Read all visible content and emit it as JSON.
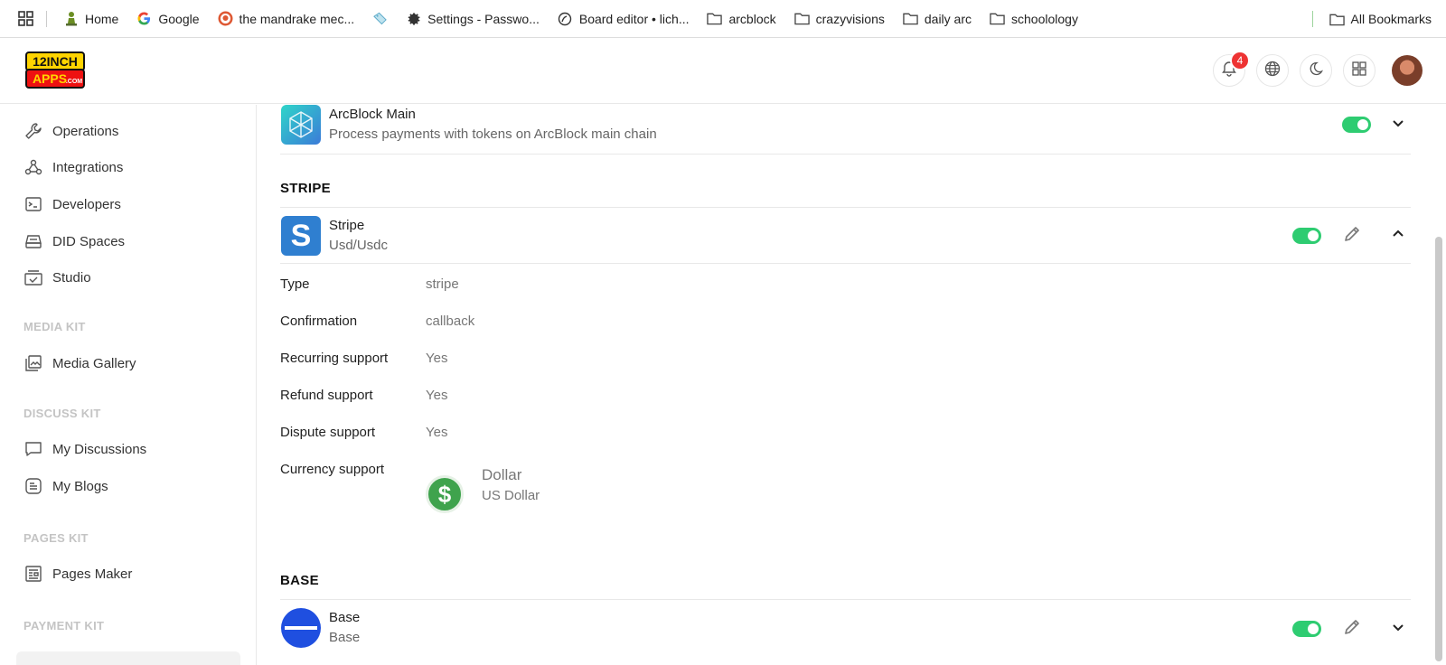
{
  "bookmarks": {
    "items": [
      {
        "label": "Home",
        "icon": "chess-pawn-icon"
      },
      {
        "label": "Google",
        "icon": "google-icon"
      },
      {
        "label": "the mandrake mec...",
        "icon": "duckduckgo-icon"
      },
      {
        "label": "",
        "icon": "tag-icon"
      },
      {
        "label": "Settings - Passwo...",
        "icon": "gear-icon"
      },
      {
        "label": "Board editor • lich...",
        "icon": "lichess-icon"
      },
      {
        "label": "arcblock",
        "icon": "folder-icon"
      },
      {
        "label": "crazyvisions",
        "icon": "folder-icon"
      },
      {
        "label": "daily arc",
        "icon": "folder-icon"
      },
      {
        "label": "schoolology",
        "icon": "folder-icon"
      }
    ],
    "all_bookmarks": "All Bookmarks"
  },
  "header": {
    "logo_text_top": "12INCH",
    "logo_text_bottom": "APPS",
    "logo_text_suffix": ".COM",
    "notification_count": "4"
  },
  "sidebar": {
    "items": [
      {
        "label": "Operations",
        "icon": "wrench-icon"
      },
      {
        "label": "Integrations",
        "icon": "webhook-icon"
      },
      {
        "label": "Developers",
        "icon": "terminal-icon"
      },
      {
        "label": "DID Spaces",
        "icon": "drive-icon"
      },
      {
        "label": "Studio",
        "icon": "studio-icon"
      }
    ],
    "sections": [
      {
        "label": "MEDIA KIT",
        "items": [
          {
            "label": "Media Gallery",
            "icon": "gallery-icon"
          }
        ]
      },
      {
        "label": "DISCUSS KIT",
        "items": [
          {
            "label": "My Discussions",
            "icon": "chat-icon"
          },
          {
            "label": "My Blogs",
            "icon": "blog-icon"
          }
        ]
      },
      {
        "label": "PAGES KIT",
        "items": [
          {
            "label": "Pages Maker",
            "icon": "pages-icon"
          }
        ]
      },
      {
        "label": "PAYMENT KIT",
        "items": []
      }
    ]
  },
  "main": {
    "arcblock": {
      "title": "ArcBlock Main",
      "subtitle": "Process payments with tokens on ArcBlock main chain",
      "enabled": true
    },
    "stripe_section": "STRIPE",
    "stripe": {
      "title": "Stripe",
      "subtitle": "Usd/Usdc",
      "icon_letter": "S",
      "enabled": true,
      "details": [
        {
          "label": "Type",
          "value": "stripe"
        },
        {
          "label": "Confirmation",
          "value": "callback"
        },
        {
          "label": "Recurring support",
          "value": "Yes"
        },
        {
          "label": "Refund support",
          "value": "Yes"
        },
        {
          "label": "Dispute support",
          "value": "Yes"
        },
        {
          "label": "Currency support",
          "value": ""
        }
      ],
      "currency": {
        "name": "Dollar",
        "sub": "US Dollar",
        "symbol": "$"
      }
    },
    "base_section": "BASE",
    "base": {
      "title": "Base",
      "subtitle": "Base",
      "enabled": true
    }
  },
  "colors": {
    "toggle_on": "#2ecc71",
    "stripe_blue": "#2f7fd0",
    "base_blue": "#1f4fe0",
    "currency_green": "#3fa34d",
    "badge_red": "#e33333"
  }
}
